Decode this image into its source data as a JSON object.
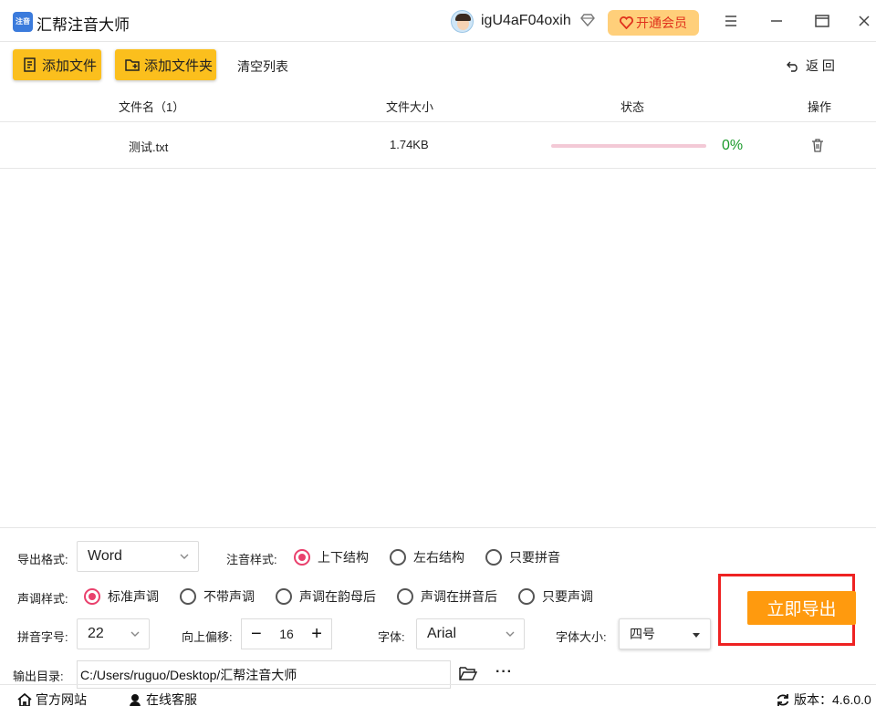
{
  "app": {
    "title": "汇帮注音大师",
    "logo_text": "注音"
  },
  "header": {
    "username": "igU4aF04oxih",
    "vip_label": "开通会员"
  },
  "window_controls": {
    "menu": "menu-icon",
    "minimize": "minimize-icon",
    "maximize": "maximize-icon",
    "close": "close-icon"
  },
  "toolbar": {
    "add_file": "添加文件",
    "add_folder": "添加文件夹",
    "clear_list": "清空列表",
    "back": "返 回"
  },
  "table": {
    "headers": {
      "name": "文件名（1）",
      "size": "文件大小",
      "status": "状态",
      "action": "操作"
    },
    "rows": [
      {
        "name": "测试.txt",
        "size": "1.74KB",
        "progress": 0,
        "percent": "0%"
      }
    ]
  },
  "settings": {
    "export_format_label": "导出格式:",
    "export_format_value": "Word",
    "annotation_style_label": "注音样式:",
    "annotation_style_options": [
      "上下结构",
      "左右结构",
      "只要拼音"
    ],
    "annotation_style_selected": "上下结构",
    "tone_style_label": "声调样式:",
    "tone_style_options": [
      "标准声调",
      "不带声调",
      "声调在韵母后",
      "声调在拼音后",
      "只要声调"
    ],
    "tone_style_selected": "标准声调",
    "pinyin_size_label": "拼音字号:",
    "pinyin_size_value": "22",
    "offset_label": "向上偏移:",
    "offset_value": "16",
    "font_label": "字体:",
    "font_value": "Arial",
    "font_size_label": "字体大小:",
    "font_size_value": "四号",
    "output_dir_label": "输出目录:",
    "output_dir_value": "C:/Users/ruguo/Desktop/汇帮注音大师",
    "more": "···",
    "export_button": "立即导出"
  },
  "statusbar": {
    "website": "官方网站",
    "support": "在线客服",
    "version": "版本：4.6.0.0"
  },
  "colors": {
    "accent_yellow": "#fbbf1d",
    "export_orange": "#ff9a0e",
    "radio_pink": "#e9406c",
    "progress_pink": "#f3c9d6",
    "percent_green": "#1a9a2a",
    "highlight_red": "#ee2222"
  }
}
